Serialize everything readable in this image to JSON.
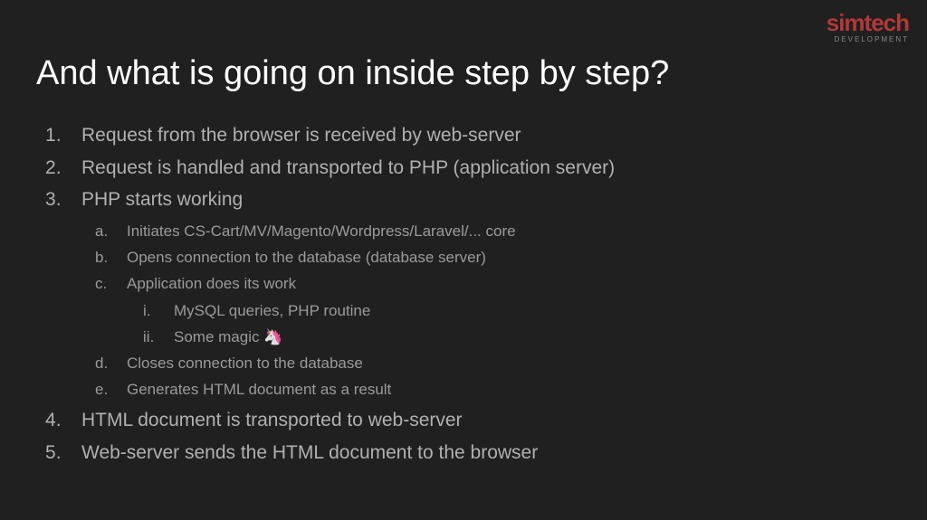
{
  "logo": {
    "main": "simtech",
    "sub": "DEVELOPMENT"
  },
  "title": "And what is going on inside step by step?",
  "items": [
    {
      "text": "Request from the browser is received by web-server"
    },
    {
      "text": "Request is handled and transported to PHP (application server)"
    },
    {
      "text": "PHP starts working",
      "children": [
        {
          "text": "Initiates CS-Cart/MV/Magento/Wordpress/Laravel/... core"
        },
        {
          "text": "Opens connection to the database (database server)"
        },
        {
          "text": "Application does its work",
          "children": [
            {
              "text": "MySQL queries, PHP routine"
            },
            {
              "text": "Some magic 🦄"
            }
          ]
        },
        {
          "text": "Closes connection to the database"
        },
        {
          "text": "Generates HTML document as a result"
        }
      ]
    },
    {
      "text": "HTML document is transported to web-server"
    },
    {
      "text": "Web-server sends the HTML document to the browser"
    }
  ]
}
